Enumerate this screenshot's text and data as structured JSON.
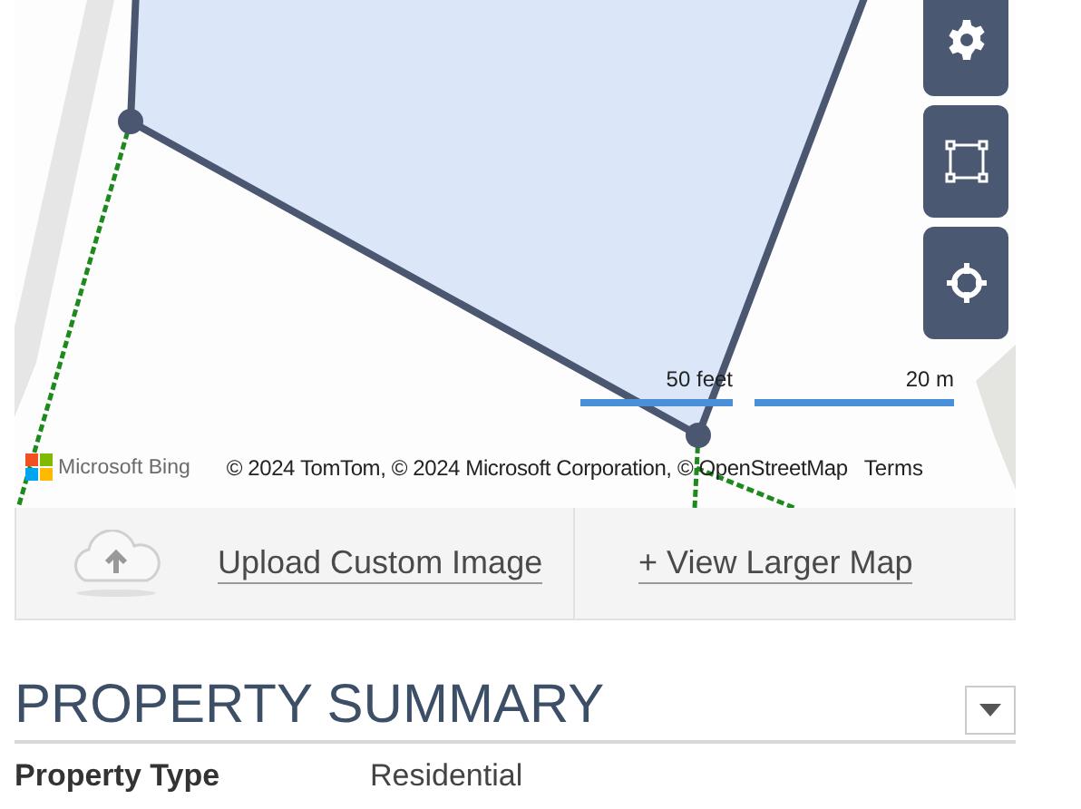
{
  "map": {
    "controls": [
      {
        "kind": "settings"
      },
      {
        "kind": "select-area"
      },
      {
        "kind": "locate"
      }
    ],
    "scale": [
      {
        "label": "50 feet"
      },
      {
        "label": "20 m"
      }
    ],
    "logo": "Microsoft Bing",
    "attribution": "© 2024 TomTom, © 2024 Microsoft Corporation, © OpenStreetMap",
    "terms": "Terms"
  },
  "actions": [
    {
      "kind": "upload",
      "label": "Upload Custom Image"
    },
    {
      "kind": "link",
      "label": "+ View Larger Map"
    }
  ],
  "section": {
    "title": "PROPERTY SUMMARY",
    "fields": [
      {
        "label": "Property Type",
        "value": "Residential"
      }
    ]
  }
}
